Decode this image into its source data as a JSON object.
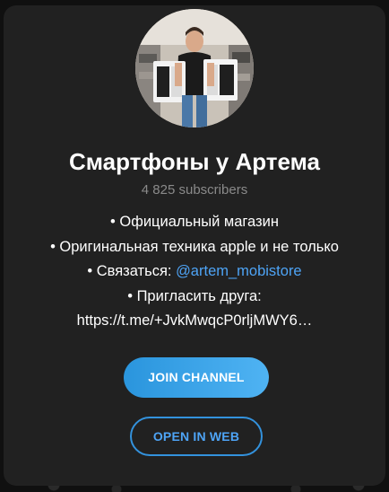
{
  "channel": {
    "title": "Смартфоны у Артема",
    "subscribers": "4 825 subscribers",
    "description": {
      "line1": "• Официальный магазин",
      "line2": "• Оригинальная техника apple и не только",
      "line3_prefix": "• Связаться: ",
      "line3_link": "@artem_mobistore",
      "line4": "• Пригласить друга:",
      "line5": "https://t.me/+JvkMwqcP0rljMWY6…"
    }
  },
  "buttons": {
    "join_label": "JOIN CHANNEL",
    "open_web_label": "OPEN IN WEB"
  },
  "colors": {
    "card_background": "#212121",
    "accent": "#4ea4f6",
    "join_gradient_start": "#2a95dd",
    "join_gradient_end": "#4fb3f3"
  }
}
